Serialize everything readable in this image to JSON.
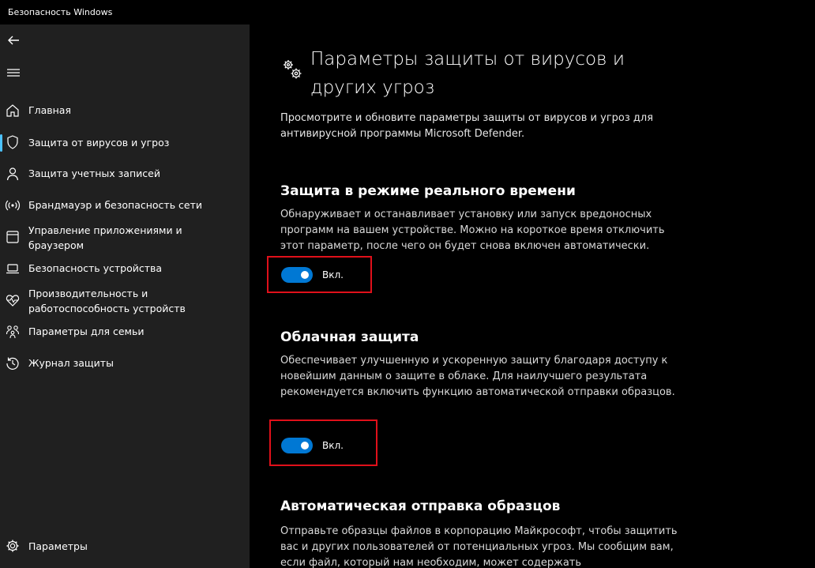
{
  "window": {
    "title": "Безопасность Windows"
  },
  "sidebar": {
    "items": [
      {
        "label": "Главная"
      },
      {
        "label": "Защита от вирусов и угроз"
      },
      {
        "label": "Защита учетных записей"
      },
      {
        "label": "Брандмауэр и безопасность сети"
      },
      {
        "label": "Управление приложениями и браузером"
      },
      {
        "label": "Безопасность устройства"
      },
      {
        "label": "Производительность и работоспособность устройств"
      },
      {
        "label": "Параметры для семьи"
      },
      {
        "label": "Журнал защиты"
      }
    ],
    "settings_label": "Параметры"
  },
  "main": {
    "title": "Параметры защиты от вирусов и других угроз",
    "description": "Просмотрите и обновите параметры защиты от вирусов и угроз для антивирусной программы Microsoft Defender.",
    "sections": [
      {
        "title": "Защита в режиме реального времени",
        "description": "Обнаруживает и останавливает установку или запуск вредоносных программ на вашем устройстве. Можно на короткое время отключить этот параметр, после чего он будет снова включен автоматически.",
        "toggle_label": "Вкл."
      },
      {
        "title": "Облачная защита",
        "description": "Обеспечивает улучшенную и ускоренную защиту благодаря доступу к новейшим данным о защите в облаке. Для наилучшего результата рекомендуется включить функцию автоматической отправки образцов.",
        "toggle_label": "Вкл."
      },
      {
        "title": "Автоматическая отправка образцов",
        "description": "Отправьте образцы файлов в корпорацию Майкрософт, чтобы защитить вас и других пользователей от потенциальных угроз. Мы сообщим вам, если файл, который нам необходим, может содержать"
      }
    ]
  },
  "colors": {
    "accent": "#0078d4",
    "highlight": "#e0101a",
    "sidebar_bg": "#202020"
  }
}
